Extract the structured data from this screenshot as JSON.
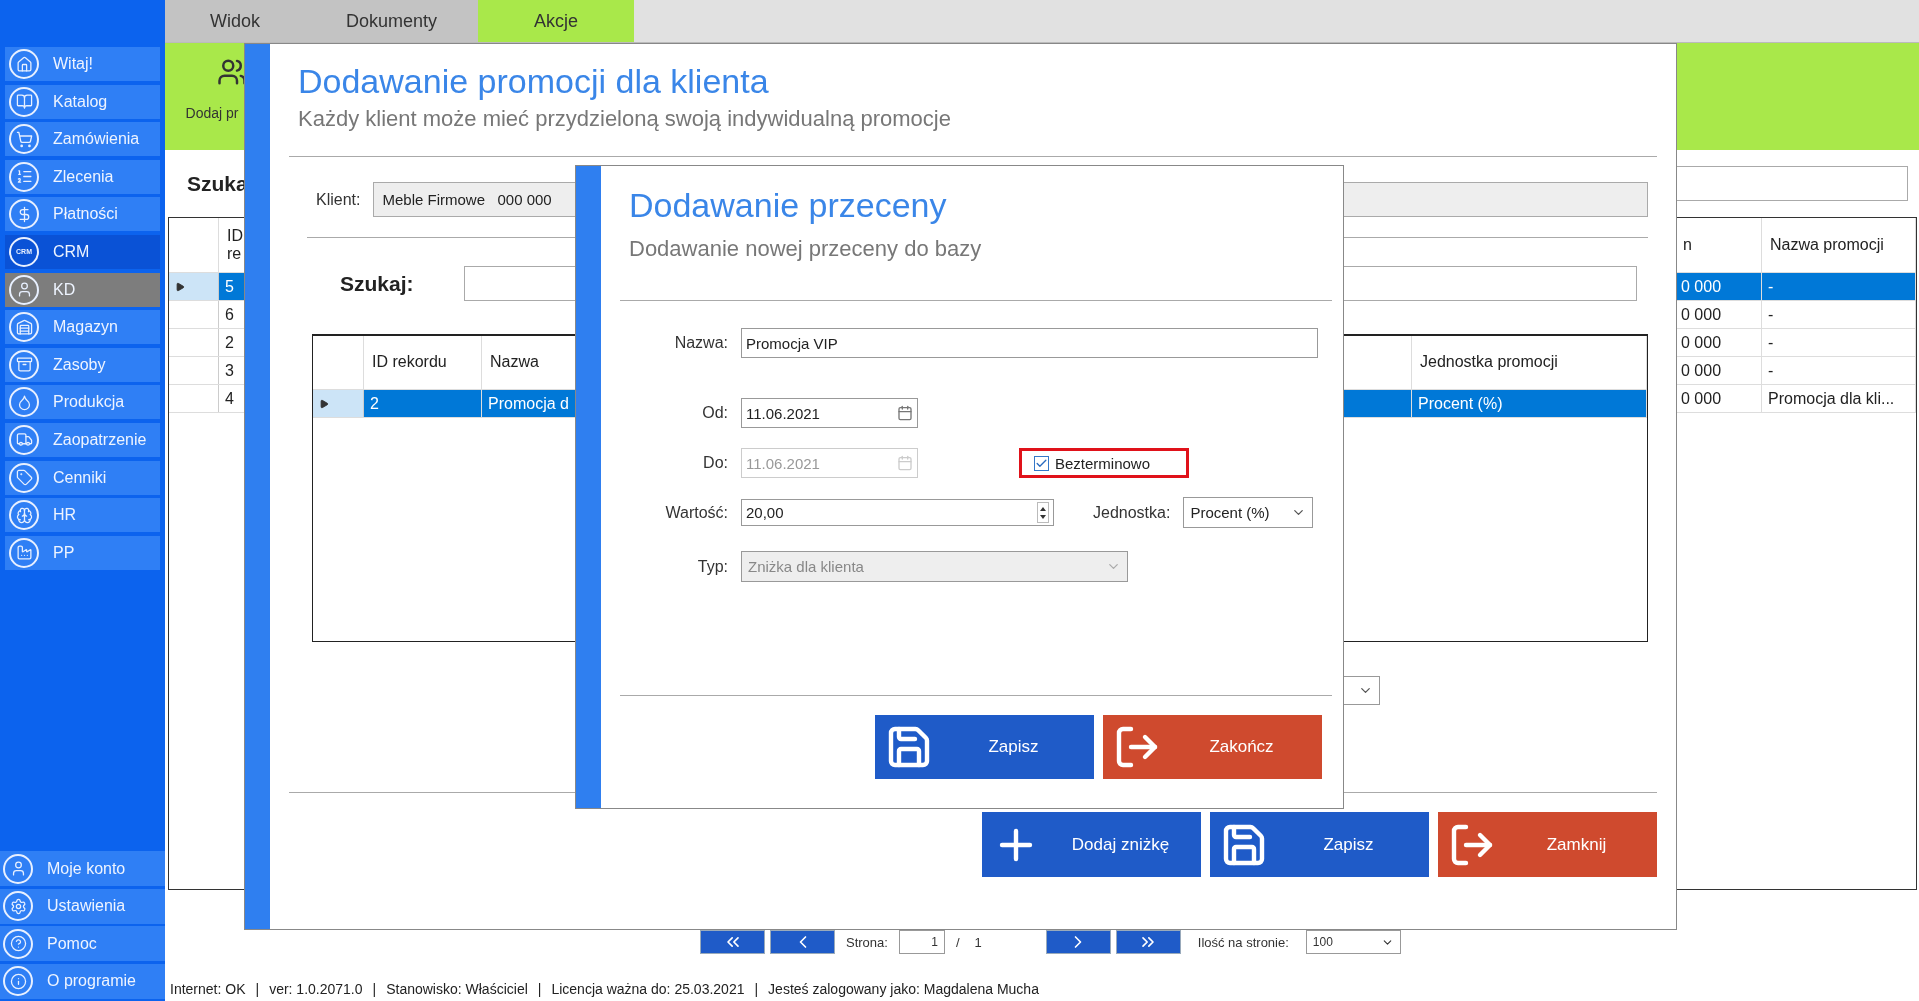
{
  "sidebar": {
    "items": [
      {
        "label": "Witaj!",
        "selected": false,
        "active": false
      },
      {
        "label": "Katalog",
        "selected": false,
        "active": false
      },
      {
        "label": "Zamówienia",
        "selected": false,
        "active": false
      },
      {
        "label": "Zlecenia",
        "selected": false,
        "active": false
      },
      {
        "label": "Płatności",
        "selected": false,
        "active": false
      },
      {
        "label": "CRM",
        "selected": false,
        "active": true,
        "badge": "CRM"
      },
      {
        "label": "KD",
        "selected": true,
        "active": false
      },
      {
        "label": "Magazyn",
        "selected": false,
        "active": false
      },
      {
        "label": "Zasoby",
        "selected": false,
        "active": false
      },
      {
        "label": "Produkcja",
        "selected": false,
        "active": false
      },
      {
        "label": "Zaopatrzenie",
        "selected": false,
        "active": false
      },
      {
        "label": "Cenniki",
        "selected": false,
        "active": false
      },
      {
        "label": "HR",
        "selected": false,
        "active": false
      },
      {
        "label": "PP",
        "selected": false,
        "active": false
      }
    ],
    "footer_items": [
      {
        "label": "Moje konto"
      },
      {
        "label": "Ustawienia"
      },
      {
        "label": "Pomoc"
      },
      {
        "label": "O programie"
      }
    ]
  },
  "menu": {
    "tabs": [
      {
        "label": "Widok",
        "selected": false
      },
      {
        "label": "Dokumenty",
        "selected": false
      },
      {
        "label": "Akcje",
        "selected": true
      }
    ]
  },
  "ribbon": {
    "button_label": "Dodaj pr"
  },
  "search": {
    "label": "Szuka"
  },
  "table": {
    "columns": [
      "ID re",
      "n",
      "Nazwa promocji"
    ],
    "rows": [
      {
        "id": "5",
        "column_2": "0 000",
        "promotion": "-",
        "selected": true
      },
      {
        "id": "6",
        "column_2": "0 000",
        "promotion": "-",
        "selected": false
      },
      {
        "id": "2",
        "column_2": "0 000",
        "promotion": "-",
        "selected": false
      },
      {
        "id": "3",
        "column_2": "0 000",
        "promotion": "-",
        "selected": false
      },
      {
        "id": "4",
        "column_2": "0 000",
        "promotion": "Promocja dla kli...",
        "selected": false
      }
    ]
  },
  "pager": {
    "buttons": [
      {
        "kind": "first"
      },
      {
        "kind": "prev"
      },
      {
        "kind": "next"
      },
      {
        "kind": "last"
      }
    ],
    "page_label": "Strona:",
    "page": "1",
    "separator": "/",
    "total": "1",
    "per_page_label": "Ilość na stronie:",
    "per_page": "100"
  },
  "status_bar": {
    "separator": "|",
    "items": [
      "Internet: OK",
      "ver: 1.0.2071.0",
      "Stanowisko: Właściciel",
      "Licencja ważna do: 25.03.2021",
      "Jesteś zalogowany jako: Magdalena Mucha"
    ]
  },
  "promo_dialog": {
    "title": "Dodawanie promocji dla klienta",
    "subtitle": "Każdy klient może mieć przydzieloną swoją indywidualną promocje",
    "client_label": "Klient:",
    "client_value": "Meble Firmowe   000 000",
    "search_label": "Szukaj:",
    "columns": [
      "ID rekordu",
      "Nazwa",
      "Jednostka promocji"
    ],
    "rows": [
      {
        "id": "2",
        "name": "Promocja d",
        "unit": "Procent (%)",
        "selected": true
      }
    ],
    "buttons": [
      {
        "kind": "add",
        "label": "Dodaj zniżkę"
      },
      {
        "kind": "save",
        "label": "Zapisz"
      },
      {
        "kind": "exit",
        "label": "Zamknij"
      }
    ]
  },
  "price_dialog": {
    "title": "Dodawanie przeceny",
    "subtitle": "Dodawanie nowej przeceny do bazy",
    "fields": [
      {
        "kind": "text",
        "label": "Nazwa:",
        "value": "Promocja VIP",
        "disabled": false
      },
      {
        "kind": "date",
        "label": "Od:",
        "value": "11.06.2021",
        "disabled": false
      },
      {
        "kind": "date",
        "label": "Do:",
        "value": "11.06.2021",
        "disabled": true,
        "checkbox": {
          "label": "Bezterminowo",
          "checked": true,
          "highlighted": true
        }
      },
      {
        "kind": "number",
        "label": "Wartość:",
        "value": "20,00",
        "disabled": false,
        "unit": {
          "label": "Jednostka:",
          "value": "Procent (%)"
        }
      },
      {
        "kind": "select",
        "label": "Typ:",
        "value": "Zniżka dla klienta",
        "disabled": true
      }
    ],
    "buttons": [
      {
        "kind": "save",
        "label": "Zapisz"
      },
      {
        "kind": "exit",
        "label": "Zakończ"
      }
    ]
  }
}
